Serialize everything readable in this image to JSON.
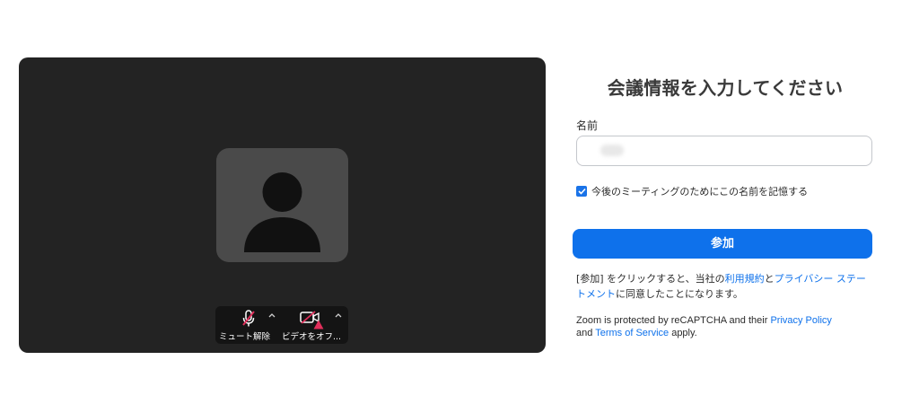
{
  "preview": {
    "mute_label": "ミュート解除",
    "video_label": "ビデオをオフ..."
  },
  "icons": {
    "avatar": "person-icon",
    "mic": "mic-muted-icon",
    "camera": "camera-off-icon",
    "warning": "warning-icon",
    "caret": "chevron-up-icon",
    "checkbox": "check-icon"
  },
  "colors": {
    "accent": "#0e71eb",
    "muted_red": "#e02f5b",
    "preview_bg": "#232323"
  },
  "form": {
    "title": "会議情報を入力してください",
    "name_label": "名前",
    "name_value": "",
    "remember_label": "今後のミーティングのためにこの名前を記憶する",
    "remember_checked": true,
    "join_button": "参加",
    "terms": {
      "prefix": "[参加] をクリックすると、当社の",
      "tos_link": "利用規約",
      "and": "と",
      "privacy_link": "プライバシー ステートメント",
      "suffix": "に同意したことになります。"
    },
    "captcha": {
      "prefix": "Zoom is protected by reCAPTCHA and their ",
      "privacy_link": "Privacy Policy",
      "and": " and ",
      "tos_link": "Terms of Service",
      "suffix": " apply."
    }
  }
}
